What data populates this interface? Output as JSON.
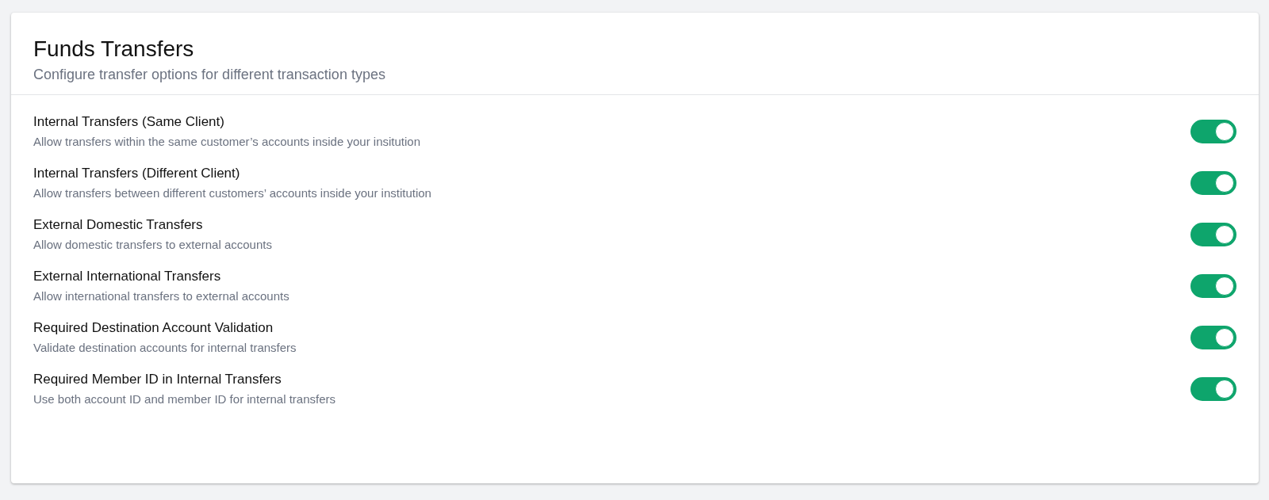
{
  "card": {
    "title": "Funds Transfers",
    "subtitle": "Configure transfer options for different transaction types"
  },
  "settings": [
    {
      "label": "Internal Transfers (Same Client)",
      "description": "Allow transfers within the same customer’s accounts inside your insitution",
      "on": true
    },
    {
      "label": "Internal Transfers (Different Client)",
      "description": "Allow transfers between different customers’ accounts inside your institution",
      "on": true
    },
    {
      "label": "External Domestic Transfers",
      "description": "Allow domestic transfers to external accounts",
      "on": true
    },
    {
      "label": "External International Transfers",
      "description": "Allow international transfers to external accounts",
      "on": true
    },
    {
      "label": "Required Destination Account Validation",
      "description": "Validate destination accounts for internal transfers",
      "on": true
    },
    {
      "label": "Required Member ID in Internal Transfers",
      "description": "Use both account ID and member ID for internal transfers",
      "on": true
    }
  ]
}
